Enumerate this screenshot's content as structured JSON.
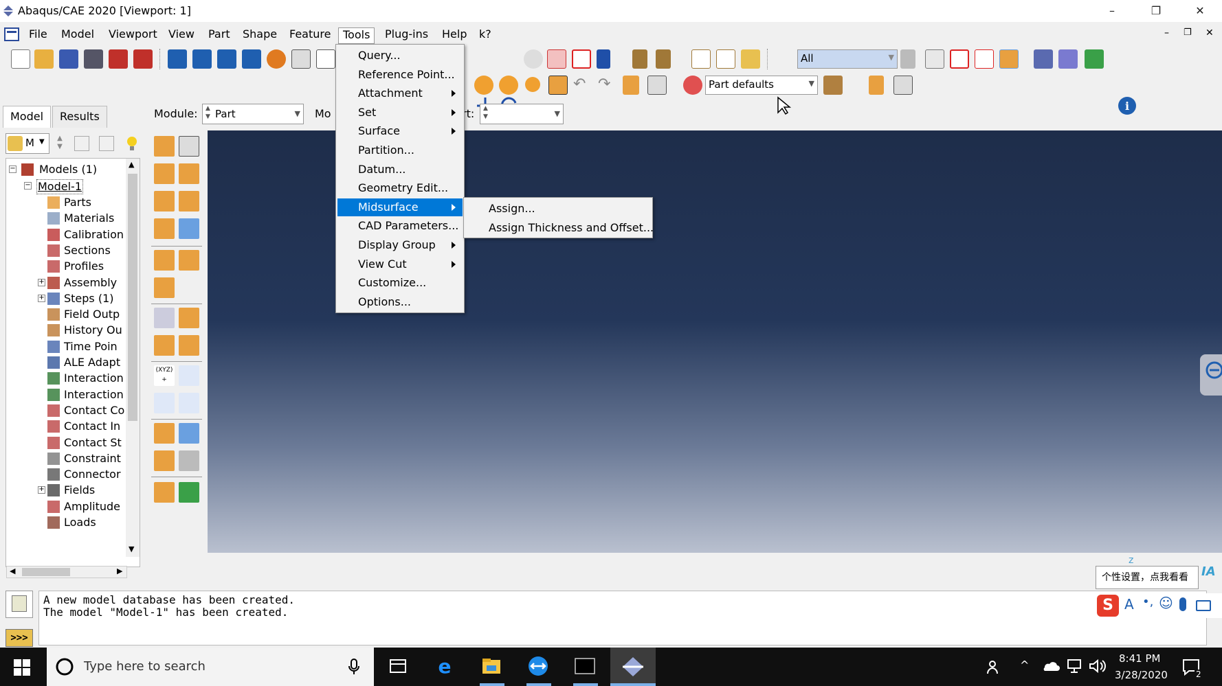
{
  "window": {
    "title": "Abaqus/CAE 2020 [Viewport: 1]",
    "minimize": "–",
    "maximize": "❐",
    "close": "✕"
  },
  "menubar": [
    "File",
    "Model",
    "Viewport",
    "View",
    "Part",
    "Shape",
    "Feature",
    "Tools",
    "Plug-ins",
    "Help",
    "k?"
  ],
  "mdi_buttons": [
    "–",
    "❐",
    "✕"
  ],
  "toolbar": {
    "selection_filter": "All",
    "render_style": "Part defaults"
  },
  "left_tabs": [
    "Model",
    "Results"
  ],
  "model_selector": "M",
  "module_bar": {
    "module_label": "Module:",
    "module_value": "Part",
    "model_label": "Mo",
    "part_label": "rt:",
    "part_value": ""
  },
  "tree": {
    "root": "Models (1)",
    "model": "Model-1",
    "items": [
      "Parts",
      "Materials",
      "Calibration",
      "Sections",
      "Profiles",
      "Assembly",
      "Steps (1)",
      "Field Outp",
      "History Ou",
      "Time Poin",
      "ALE Adapt",
      "Interaction",
      "Interaction",
      "Contact Co",
      "Contact In",
      "Contact St",
      "Constraint",
      "Connector",
      "Fields",
      "Amplitude",
      "Loads"
    ]
  },
  "tools_menu": [
    "Query...",
    "Reference Point...",
    "Attachment",
    "Set",
    "Surface",
    "Partition...",
    "Datum...",
    "Geometry Edit...",
    "Midsurface",
    "CAD Parameters...",
    "Display Group",
    "View Cut",
    "Customize...",
    "Options..."
  ],
  "midsurface_menu": [
    "Assign...",
    "Assign Thickness and Offset..."
  ],
  "messages": [
    "A new model database has been created.",
    "The model \"Model-1\" has been created."
  ],
  "ime": {
    "tooltip": "个性设置，点我看看",
    "mode": "A",
    "brand": "IA"
  },
  "viewport_misc": {
    "triad_label": "z"
  },
  "taskbar": {
    "search_placeholder": "Type here to search",
    "time": "8:41 PM",
    "date": "3/28/2020",
    "notifications": "2"
  },
  "colors": {
    "menu_highlight": "#0078d7",
    "viewport_top": "#1e2d4a",
    "viewport_bottom": "#b9c0cf"
  }
}
